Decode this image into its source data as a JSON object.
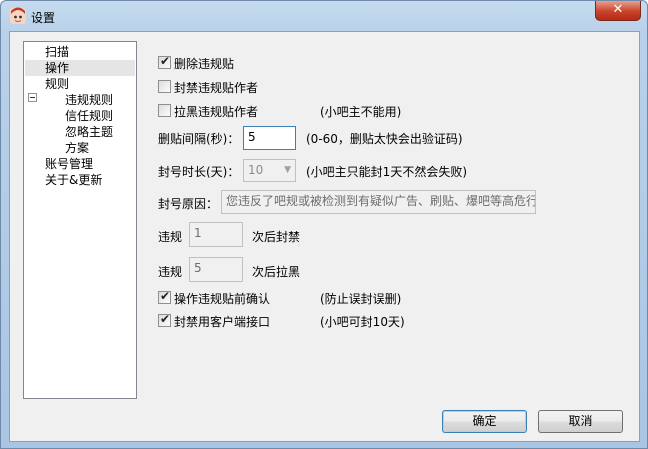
{
  "window": {
    "title": "设置",
    "close_glyph": "✕"
  },
  "tree": {
    "items": [
      {
        "label": "扫描"
      },
      {
        "label": "操作",
        "selected": true
      },
      {
        "label": "规则",
        "expanded": true,
        "expander_glyph": "−"
      },
      {
        "label": "违规规则"
      },
      {
        "label": "信任规则"
      },
      {
        "label": "忽略主题"
      },
      {
        "label": "方案"
      },
      {
        "label": "账号管理"
      },
      {
        "label": "关于&更新"
      }
    ]
  },
  "options": {
    "delete_post": {
      "label": "删除违规贴",
      "checked": true
    },
    "ban_author": {
      "label": "封禁违规贴作者",
      "checked": false
    },
    "blacklist_author": {
      "label": "拉黑违规贴作者",
      "checked": false,
      "note": "(小吧主不能用)"
    },
    "delete_interval": {
      "label": "删贴间隔(秒)：",
      "value": "5",
      "note": "(0-60，删贴太快会出验证码)"
    },
    "ban_duration": {
      "label": "封号时长(天)：",
      "value": "10",
      "note": "(小吧主只能封1天不然会失败)"
    },
    "ban_reason": {
      "label": "封号原因：",
      "value": "您违反了吧规或被检测到有疑似广告、刷贴、爆吧等高危行"
    },
    "ban_after": {
      "prefix": "违规",
      "value": "1",
      "suffix": "次后封禁"
    },
    "blacklist_after": {
      "prefix": "违规",
      "value": "5",
      "suffix": "次后拉黑"
    },
    "confirm_before": {
      "label": "操作违规贴前确认",
      "checked": true,
      "note": "(防止误封误删)"
    },
    "client_api": {
      "label": "封禁用客户端接口",
      "checked": true,
      "note": "(小吧可封10天)"
    }
  },
  "buttons": {
    "ok": "确定",
    "cancel": "取消"
  }
}
